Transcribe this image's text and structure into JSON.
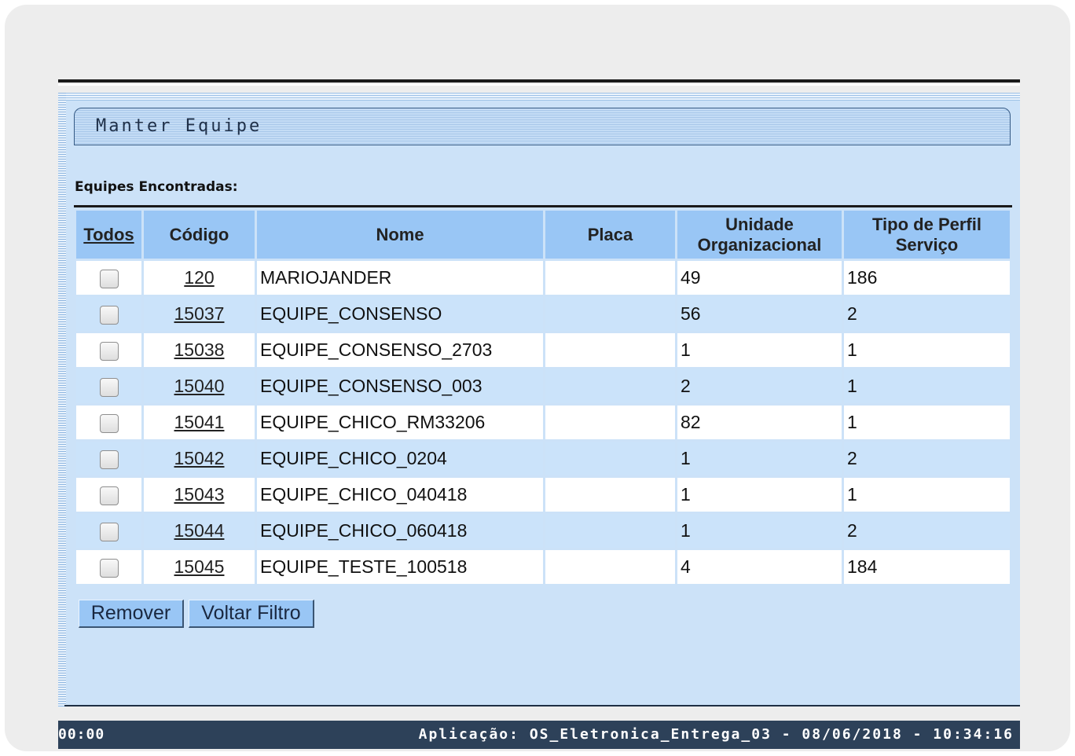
{
  "window": {
    "title": "Manter Equipe"
  },
  "section_label": "Equipes Encontradas:",
  "table": {
    "columns": {
      "todos": "Todos",
      "codigo": "Código",
      "nome": "Nome",
      "placa": "Placa",
      "unidade_line1": "Unidade",
      "unidade_line2": "Organizacional",
      "tipo_line1": "Tipo de Perfil",
      "tipo_line2": "Serviço"
    },
    "rows": [
      {
        "codigo": "120",
        "nome": "MARIOJANDER",
        "placa": "",
        "unidade": "49",
        "tipo": "186"
      },
      {
        "codigo": "15037",
        "nome": "EQUIPE_CONSENSO",
        "placa": "",
        "unidade": "56",
        "tipo": "2"
      },
      {
        "codigo": "15038",
        "nome": "EQUIPE_CONSENSO_2703",
        "placa": "",
        "unidade": "1",
        "tipo": "1"
      },
      {
        "codigo": "15040",
        "nome": "EQUIPE_CONSENSO_003",
        "placa": "",
        "unidade": "2",
        "tipo": "1"
      },
      {
        "codigo": "15041",
        "nome": "EQUIPE_CHICO_RM33206",
        "placa": "",
        "unidade": "82",
        "tipo": "1"
      },
      {
        "codigo": "15042",
        "nome": "EQUIPE_CHICO_0204",
        "placa": "",
        "unidade": "1",
        "tipo": "2"
      },
      {
        "codigo": "15043",
        "nome": "EQUIPE_CHICO_040418",
        "placa": "",
        "unidade": "1",
        "tipo": "1"
      },
      {
        "codigo": "15044",
        "nome": "EQUIPE_CHICO_060418",
        "placa": "",
        "unidade": "1",
        "tipo": "2"
      },
      {
        "codigo": "15045",
        "nome": "EQUIPE_TESTE_100518",
        "placa": "",
        "unidade": "4",
        "tipo": "184"
      }
    ]
  },
  "buttons": {
    "remover": "Remover",
    "voltar_filtro": "Voltar Filtro"
  },
  "statusbar": {
    "left": "00:00",
    "right": "Aplicação: OS_Eletronica_Entrega_03 - 08/06/2018 - 10:34:16"
  }
}
